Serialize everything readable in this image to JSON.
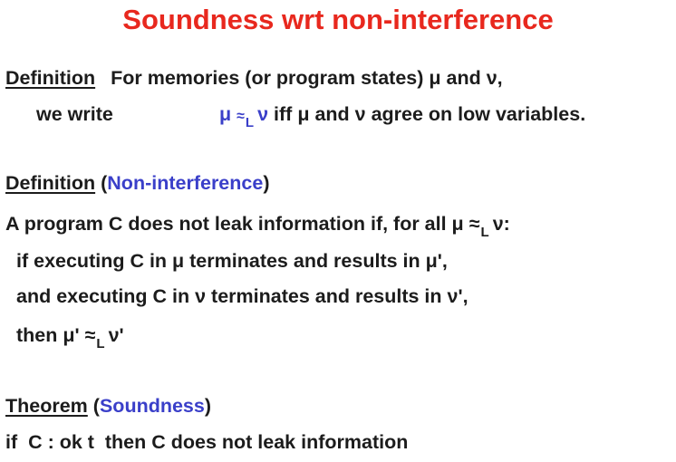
{
  "slide": {
    "title": "Soundness wrt non-interference",
    "colors": {
      "title": "#e8281e",
      "text": "#1c1c1c",
      "accent": "#3a3fc9"
    },
    "def1": {
      "heading": "Definition",
      "line1_text": "For memories (or program states) μ and ν,",
      "line2_prefix": "we write",
      "relation_left": "μ",
      "relation_op": "≈",
      "relation_sub": "L",
      "relation_right": "ν",
      "line2_suffix": "iff μ and ν agree on low variables."
    },
    "def2": {
      "heading": "Definition",
      "paren_open": "(",
      "heading_name": "Non-interference",
      "paren_close": ")",
      "line1_prefix": "A program C does not leak information if, for all μ",
      "line1_op": "≈",
      "line1_sub": "L",
      "line1_suffix": "ν:",
      "line2": "if executing C in μ terminates and results in μ',",
      "line3": "and executing C in ν terminates and results in ν',",
      "line4_prefix": "then μ'",
      "line4_op": "≈",
      "line4_sub": "L",
      "line4_suffix": "ν'"
    },
    "theorem": {
      "heading": "Theorem",
      "paren_open": "(",
      "heading_name": "Soundness",
      "paren_close": ")",
      "statement": "if  C : ok t  then C does not leak information"
    }
  }
}
